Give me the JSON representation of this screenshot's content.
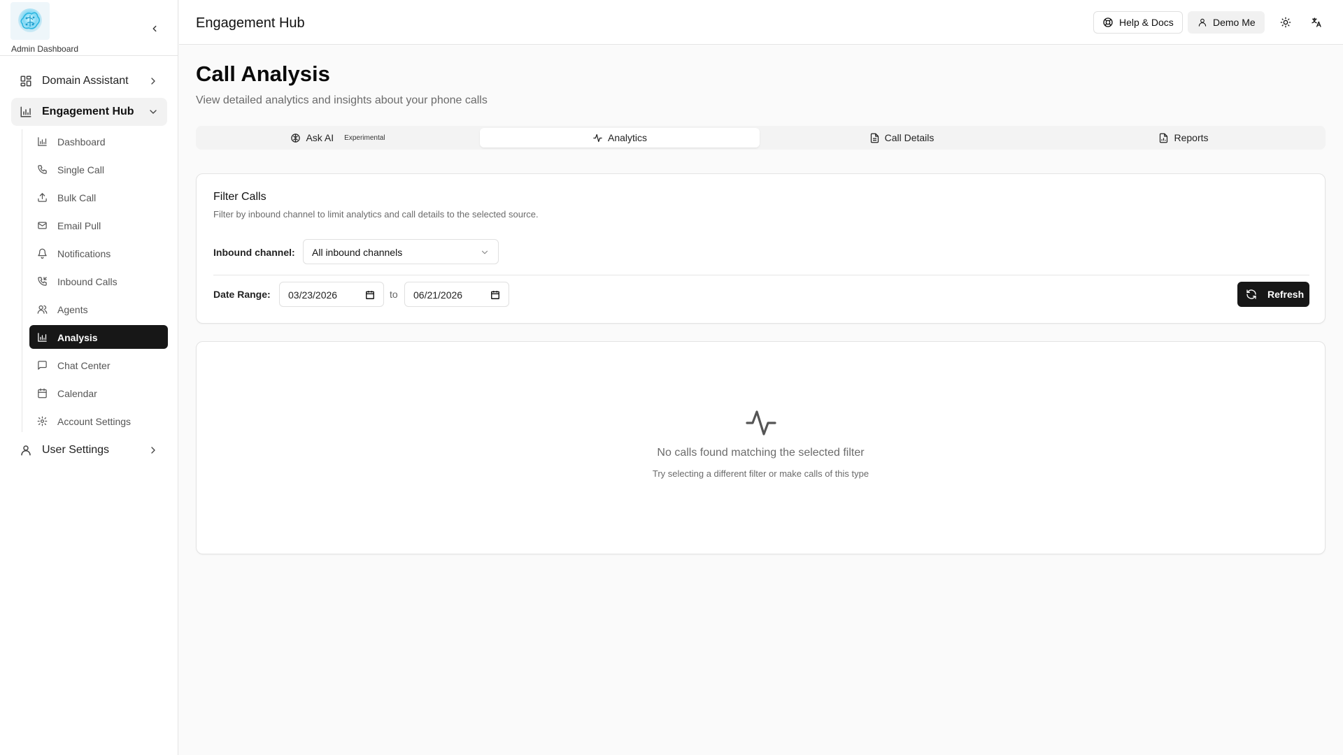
{
  "sidebar": {
    "brand_label": "Admin Dashboard",
    "top_items": [
      {
        "label": "Domain Assistant",
        "icon": "grid-icon"
      },
      {
        "label": "Engagement Hub",
        "icon": "bar-chart-icon"
      },
      {
        "label": "User Settings",
        "icon": "user-icon"
      }
    ],
    "sub_items": [
      {
        "label": "Dashboard",
        "icon": "bar-chart-icon"
      },
      {
        "label": "Single Call",
        "icon": "phone-icon"
      },
      {
        "label": "Bulk Call",
        "icon": "upload-icon"
      },
      {
        "label": "Email Pull",
        "icon": "mail-icon"
      },
      {
        "label": "Notifications",
        "icon": "bell-icon"
      },
      {
        "label": "Inbound Calls",
        "icon": "phone-incoming-icon"
      },
      {
        "label": "Agents",
        "icon": "users-icon"
      },
      {
        "label": "Analysis",
        "icon": "bar-chart-icon"
      },
      {
        "label": "Chat Center",
        "icon": "message-square-icon"
      },
      {
        "label": "Calendar",
        "icon": "calendar-icon"
      },
      {
        "label": "Account Settings",
        "icon": "gear-icon"
      }
    ],
    "active_item": "Analysis"
  },
  "header": {
    "title": "Engagement Hub",
    "help_label": "Help & Docs",
    "user_label": "Demo Me"
  },
  "page": {
    "title": "Call Analysis",
    "subtitle": "View detailed analytics and insights about your phone calls"
  },
  "tabs": [
    {
      "label": "Ask AI",
      "badge": "Experimental",
      "icon": "brain-icon"
    },
    {
      "label": "Analytics",
      "icon": "activity-icon"
    },
    {
      "label": "Call Details",
      "icon": "file-text-icon"
    },
    {
      "label": "Reports",
      "icon": "file-chart-icon"
    }
  ],
  "active_tab": "Analytics",
  "filter": {
    "title": "Filter Calls",
    "description": "Filter by inbound channel to limit analytics and call details to the selected source.",
    "channel_label": "Inbound channel:",
    "channel_value": "All inbound channels",
    "date_label": "Date Range:",
    "date_from": "03/23/2026",
    "date_to_label": "to",
    "date_to": "06/21/2026",
    "refresh_label": "Refresh"
  },
  "empty_state": {
    "title": "No calls found matching the selected filter",
    "subtitle": "Try selecting a different filter or make calls of this type"
  },
  "colors": {
    "accent": "#171717",
    "background": "#fafafa",
    "border": "#e5e5e5",
    "muted_text": "#6b6b6b"
  }
}
